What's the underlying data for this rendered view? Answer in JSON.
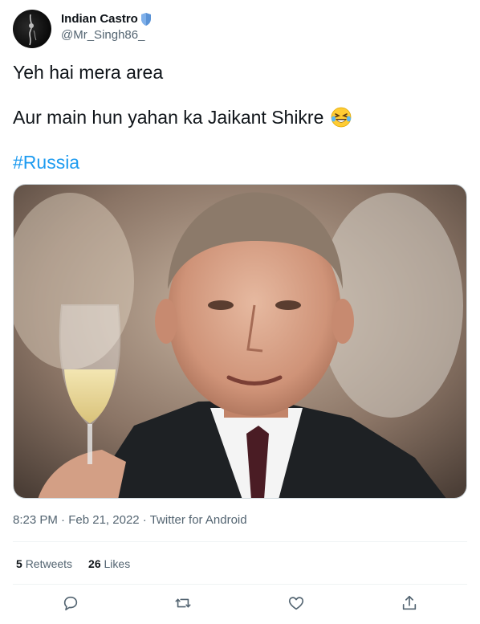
{
  "author": {
    "display_name": "Indian Castro",
    "handle": "@Mr_Singh86_",
    "badge_icon": "shield-icon",
    "badge_color": "#5b93d6"
  },
  "tweet": {
    "line1": "Yeh hai mera area",
    "line2": "Aur main hun yahan ka Jaikant Shikre",
    "emoji": "face-with-tears-of-joy",
    "hashtag": "#Russia",
    "hashtag_color": "#1d9bf0"
  },
  "meta": {
    "time": "8:23 PM",
    "date": "Feb 21, 2022",
    "source": "Twitter for Android",
    "separator": "·"
  },
  "stats": {
    "retweets_count": "5",
    "retweets_label": "Retweets",
    "likes_count": "26",
    "likes_label": "Likes"
  },
  "actions": [
    "reply-icon",
    "retweet-icon",
    "like-icon",
    "share-icon"
  ]
}
